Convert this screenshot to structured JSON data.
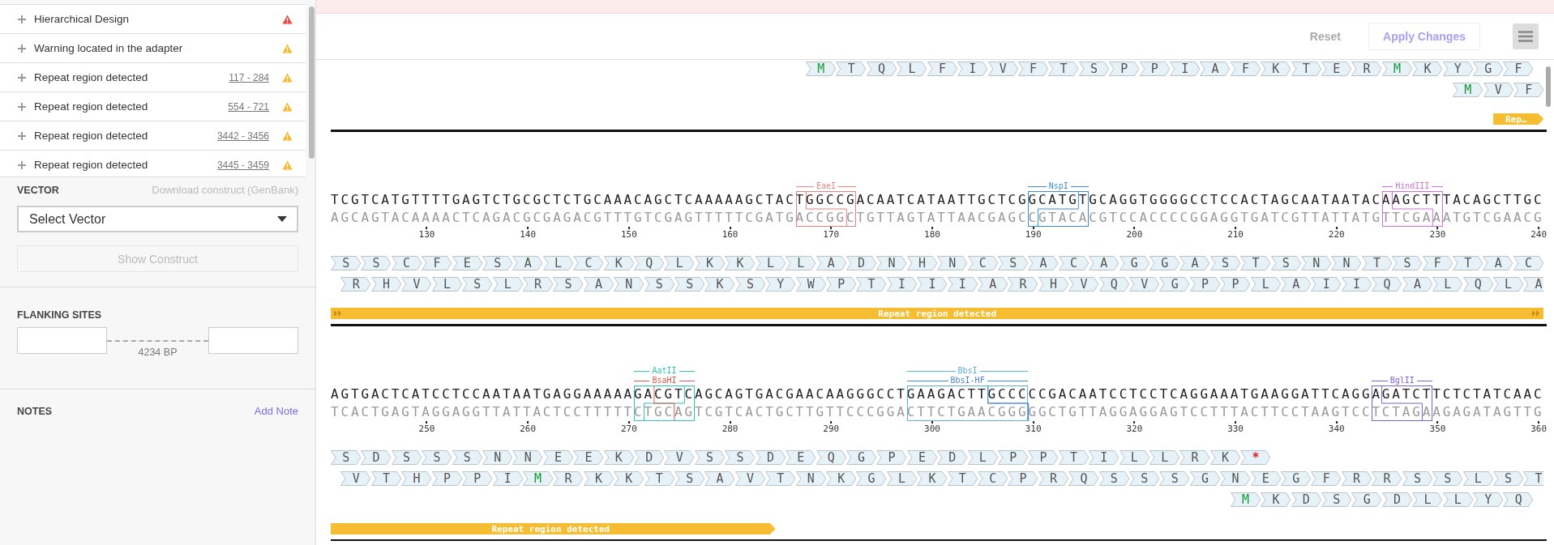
{
  "issues": [
    {
      "label": "Hierarchical Design",
      "kind": "error"
    },
    {
      "label": "Warning located in the adapter",
      "kind": "warning"
    },
    {
      "label": "Repeat region detected",
      "range": "117 - 284",
      "kind": "warning"
    },
    {
      "label": "Repeat region detected",
      "range": "554 - 721",
      "kind": "warning"
    },
    {
      "label": "Repeat region detected",
      "range": "3442 - 3456",
      "kind": "warning"
    },
    {
      "label": "Repeat region detected",
      "range": "3445 - 3459",
      "kind": "warning"
    }
  ],
  "vector": {
    "title": "VECTOR",
    "download_link": "Download construct (GenBank)",
    "select": {
      "value": "Select Vector"
    },
    "show_button": {
      "label": "Show Construct",
      "disabled": true
    }
  },
  "flanking": {
    "title": "FLANKING SITES",
    "length": "4234 BP"
  },
  "notes": {
    "title": "NOTES",
    "add_link": "Add Note"
  },
  "toolbar": {
    "reset": {
      "label": "Reset",
      "disabled": true
    },
    "apply": {
      "label": "Apply Changes",
      "disabled": true
    }
  },
  "rows": [
    {
      "tracks": [
        {
          "residues": [
            {
              "aa": "M",
              "kind": "start"
            },
            {
              "aa": "T",
              "kind": "plain"
            },
            {
              "aa": "Q",
              "kind": "plain"
            },
            {
              "aa": "L",
              "kind": "plain"
            },
            {
              "aa": "F",
              "kind": "plain"
            },
            {
              "aa": "I",
              "kind": "plain"
            },
            {
              "aa": "V",
              "kind": "plain"
            },
            {
              "aa": "F",
              "kind": "plain"
            },
            {
              "aa": "T",
              "kind": "plain"
            },
            {
              "aa": "S",
              "kind": "plain"
            },
            {
              "aa": "P",
              "kind": "plain"
            },
            {
              "aa": "P",
              "kind": "plain"
            },
            {
              "aa": "I",
              "kind": "plain"
            },
            {
              "aa": "A",
              "kind": "plain"
            },
            {
              "aa": "F",
              "kind": "plain"
            },
            {
              "aa": "K",
              "kind": "plain"
            },
            {
              "aa": "T",
              "kind": "plain"
            },
            {
              "aa": "E",
              "kind": "plain"
            },
            {
              "aa": "R",
              "kind": "plain"
            },
            {
              "aa": "M",
              "kind": "start"
            },
            {
              "aa": "K",
              "kind": "plain"
            },
            {
              "aa": "Y",
              "kind": "plain"
            },
            {
              "aa": "G",
              "kind": "plain"
            },
            {
              "aa": "F",
              "kind": "plain"
            }
          ]
        },
        {
          "residues": [
            {
              "aa": "M",
              "kind": "start"
            },
            {
              "aa": "V",
              "kind": "plain"
            },
            {
              "aa": "F",
              "kind": "plain"
            }
          ]
        }
      ],
      "features": [
        {
          "label": "Rep…"
        }
      ]
    },
    {
      "enzymes": [
        {
          "name": "EaeI",
          "color": "#f07f7f"
        },
        {
          "name": "NspI",
          "color": "#3a8fd8"
        },
        {
          "name": "HindIII",
          "color": "#d36ee0"
        }
      ],
      "top_strand": "TCGTCATGTTTTGAGTCTGCGCTCTGCAAACAGCTCAAAAAGCTACTGGCCGACAATCATAATTGCTCGGCATGTGCAGGTGGGGCCTCCACTAGCAATAATACAAGCTTTACAGCTTGC",
      "bottom_strand": "AGCAGTACAAAACTCAGACGCGAGACGTTTGTCGAGTTTTTCGATGACCGGCTGTTAGTATTAACGAGCCGTACACGTCCACCCCGGAGGTGATCGTTATTATGTTCGAAATGTCGAACG",
      "ticks": [
        "130",
        "140",
        "150",
        "160",
        "170",
        "180",
        "190",
        "200",
        "210",
        "220",
        "230",
        "240"
      ],
      "tracks": [
        {
          "residues": [
            {
              "aa": "S",
              "kind": "plain"
            },
            {
              "aa": "S",
              "kind": "plain"
            },
            {
              "aa": "C",
              "kind": "plain"
            },
            {
              "aa": "F",
              "kind": "plain"
            },
            {
              "aa": "E",
              "kind": "plain"
            },
            {
              "aa": "S",
              "kind": "plain"
            },
            {
              "aa": "A",
              "kind": "plain"
            },
            {
              "aa": "L",
              "kind": "plain"
            },
            {
              "aa": "C",
              "kind": "plain"
            },
            {
              "aa": "K",
              "kind": "plain"
            },
            {
              "aa": "Q",
              "kind": "plain"
            },
            {
              "aa": "L",
              "kind": "plain"
            },
            {
              "aa": "K",
              "kind": "plain"
            },
            {
              "aa": "K",
              "kind": "plain"
            },
            {
              "aa": "L",
              "kind": "plain"
            },
            {
              "aa": "L",
              "kind": "plain"
            },
            {
              "aa": "A",
              "kind": "plain"
            },
            {
              "aa": "D",
              "kind": "plain"
            },
            {
              "aa": "N",
              "kind": "plain"
            },
            {
              "aa": "H",
              "kind": "plain"
            },
            {
              "aa": "N",
              "kind": "plain"
            },
            {
              "aa": "C",
              "kind": "plain"
            },
            {
              "aa": "S",
              "kind": "plain"
            },
            {
              "aa": "A",
              "kind": "plain"
            },
            {
              "aa": "C",
              "kind": "plain"
            },
            {
              "aa": "A",
              "kind": "plain"
            },
            {
              "aa": "G",
              "kind": "plain"
            },
            {
              "aa": "G",
              "kind": "plain"
            },
            {
              "aa": "A",
              "kind": "plain"
            },
            {
              "aa": "S",
              "kind": "plain"
            },
            {
              "aa": "T",
              "kind": "plain"
            },
            {
              "aa": "S",
              "kind": "plain"
            },
            {
              "aa": "N",
              "kind": "plain"
            },
            {
              "aa": "N",
              "kind": "plain"
            },
            {
              "aa": "T",
              "kind": "plain"
            },
            {
              "aa": "S",
              "kind": "plain"
            },
            {
              "aa": "F",
              "kind": "plain"
            },
            {
              "aa": "T",
              "kind": "plain"
            },
            {
              "aa": "A",
              "kind": "plain"
            },
            {
              "aa": "C",
              "kind": "plain"
            }
          ]
        },
        {
          "residues": [
            {
              "aa": "R",
              "kind": "plain"
            },
            {
              "aa": "H",
              "kind": "plain"
            },
            {
              "aa": "V",
              "kind": "plain"
            },
            {
              "aa": "L",
              "kind": "plain"
            },
            {
              "aa": "S",
              "kind": "plain"
            },
            {
              "aa": "L",
              "kind": "plain"
            },
            {
              "aa": "R",
              "kind": "plain"
            },
            {
              "aa": "S",
              "kind": "plain"
            },
            {
              "aa": "A",
              "kind": "plain"
            },
            {
              "aa": "N",
              "kind": "plain"
            },
            {
              "aa": "S",
              "kind": "plain"
            },
            {
              "aa": "S",
              "kind": "plain"
            },
            {
              "aa": "K",
              "kind": "plain"
            },
            {
              "aa": "S",
              "kind": "plain"
            },
            {
              "aa": "Y",
              "kind": "plain"
            },
            {
              "aa": "W",
              "kind": "plain"
            },
            {
              "aa": "P",
              "kind": "plain"
            },
            {
              "aa": "T",
              "kind": "plain"
            },
            {
              "aa": "I",
              "kind": "plain"
            },
            {
              "aa": "I",
              "kind": "plain"
            },
            {
              "aa": "I",
              "kind": "plain"
            },
            {
              "aa": "A",
              "kind": "plain"
            },
            {
              "aa": "R",
              "kind": "plain"
            },
            {
              "aa": "H",
              "kind": "plain"
            },
            {
              "aa": "V",
              "kind": "plain"
            },
            {
              "aa": "Q",
              "kind": "plain"
            },
            {
              "aa": "V",
              "kind": "plain"
            },
            {
              "aa": "G",
              "kind": "plain"
            },
            {
              "aa": "P",
              "kind": "plain"
            },
            {
              "aa": "P",
              "kind": "plain"
            },
            {
              "aa": "L",
              "kind": "plain"
            },
            {
              "aa": "A",
              "kind": "plain"
            },
            {
              "aa": "I",
              "kind": "plain"
            },
            {
              "aa": "I",
              "kind": "plain"
            },
            {
              "aa": "Q",
              "kind": "plain"
            },
            {
              "aa": "A",
              "kind": "plain"
            },
            {
              "aa": "L",
              "kind": "plain"
            },
            {
              "aa": "Q",
              "kind": "plain"
            },
            {
              "aa": "L",
              "kind": "plain"
            },
            {
              "aa": "A",
              "kind": "plain"
            }
          ]
        }
      ],
      "features": [
        {
          "label": "Repeat region detected"
        }
      ]
    },
    {
      "enzymes": [
        {
          "name": "AatII",
          "color": "#2cc7b8"
        },
        {
          "name": "BbsI",
          "color": "#5aaee0"
        },
        {
          "name": "BsaHI",
          "color": "#d9584f"
        },
        {
          "name": "BbsI-HF",
          "color": "#4a80d8"
        },
        {
          "name": "BglII",
          "color": "#7a63e0"
        }
      ],
      "top_strand": "AGTGACTCATCCTCCAATAATGAGGAAAAAGACGTCAGCAGTGACGAACAAGGGCCTGAAGACTTGCCCCCGACAATCCTCCTCAGGAAATGAAGGATTCAGGAGATCTTCTCTATCAAC",
      "bottom_strand": "TCACTGAGTAGGAGGTTATTACTCCTTTTTCTGCAGTCGTCACTGCTTGTTCCCGGACTTCTGAACGGGGGCTGTTAGGAGGAGTCCTTTACTTCCTAAGTCCTCTAGAAGAGATAGTTG",
      "ticks": [
        "250",
        "260",
        "270",
        "280",
        "290",
        "300",
        "310",
        "320",
        "330",
        "340",
        "350",
        "360"
      ],
      "tracks": [
        {
          "residues": [
            {
              "aa": "S",
              "kind": "plain"
            },
            {
              "aa": "D",
              "kind": "plain"
            },
            {
              "aa": "S",
              "kind": "plain"
            },
            {
              "aa": "S",
              "kind": "plain"
            },
            {
              "aa": "S",
              "kind": "plain"
            },
            {
              "aa": "N",
              "kind": "plain"
            },
            {
              "aa": "N",
              "kind": "plain"
            },
            {
              "aa": "E",
              "kind": "plain"
            },
            {
              "aa": "E",
              "kind": "plain"
            },
            {
              "aa": "K",
              "kind": "plain"
            },
            {
              "aa": "D",
              "kind": "plain"
            },
            {
              "aa": "V",
              "kind": "plain"
            },
            {
              "aa": "S",
              "kind": "plain"
            },
            {
              "aa": "S",
              "kind": "plain"
            },
            {
              "aa": "D",
              "kind": "plain"
            },
            {
              "aa": "E",
              "kind": "plain"
            },
            {
              "aa": "Q",
              "kind": "plain"
            },
            {
              "aa": "G",
              "kind": "plain"
            },
            {
              "aa": "P",
              "kind": "plain"
            },
            {
              "aa": "E",
              "kind": "plain"
            },
            {
              "aa": "D",
              "kind": "plain"
            },
            {
              "aa": "L",
              "kind": "plain"
            },
            {
              "aa": "P",
              "kind": "plain"
            },
            {
              "aa": "P",
              "kind": "plain"
            },
            {
              "aa": "T",
              "kind": "plain"
            },
            {
              "aa": "I",
              "kind": "plain"
            },
            {
              "aa": "L",
              "kind": "plain"
            },
            {
              "aa": "L",
              "kind": "plain"
            },
            {
              "aa": "R",
              "kind": "plain"
            },
            {
              "aa": "K",
              "kind": "plain"
            },
            {
              "aa": "*",
              "kind": "stop"
            }
          ]
        },
        {
          "residues": [
            {
              "aa": "V",
              "kind": "plain"
            },
            {
              "aa": "T",
              "kind": "plain"
            },
            {
              "aa": "H",
              "kind": "plain"
            },
            {
              "aa": "P",
              "kind": "plain"
            },
            {
              "aa": "P",
              "kind": "plain"
            },
            {
              "aa": "I",
              "kind": "plain"
            },
            {
              "aa": "M",
              "kind": "start"
            },
            {
              "aa": "R",
              "kind": "plain"
            },
            {
              "aa": "K",
              "kind": "plain"
            },
            {
              "aa": "K",
              "kind": "plain"
            },
            {
              "aa": "T",
              "kind": "plain"
            },
            {
              "aa": "S",
              "kind": "plain"
            },
            {
              "aa": "A",
              "kind": "plain"
            },
            {
              "aa": "V",
              "kind": "plain"
            },
            {
              "aa": "T",
              "kind": "plain"
            },
            {
              "aa": "N",
              "kind": "plain"
            },
            {
              "aa": "K",
              "kind": "plain"
            },
            {
              "aa": "G",
              "kind": "plain"
            },
            {
              "aa": "L",
              "kind": "plain"
            },
            {
              "aa": "K",
              "kind": "plain"
            },
            {
              "aa": "T",
              "kind": "plain"
            },
            {
              "aa": "C",
              "kind": "plain"
            },
            {
              "aa": "P",
              "kind": "plain"
            },
            {
              "aa": "R",
              "kind": "plain"
            },
            {
              "aa": "Q",
              "kind": "plain"
            },
            {
              "aa": "S",
              "kind": "plain"
            },
            {
              "aa": "S",
              "kind": "plain"
            },
            {
              "aa": "S",
              "kind": "plain"
            },
            {
              "aa": "G",
              "kind": "plain"
            },
            {
              "aa": "N",
              "kind": "plain"
            },
            {
              "aa": "E",
              "kind": "plain"
            },
            {
              "aa": "G",
              "kind": "plain"
            },
            {
              "aa": "F",
              "kind": "plain"
            },
            {
              "aa": "R",
              "kind": "plain"
            },
            {
              "aa": "R",
              "kind": "plain"
            },
            {
              "aa": "S",
              "kind": "plain"
            },
            {
              "aa": "S",
              "kind": "plain"
            },
            {
              "aa": "L",
              "kind": "plain"
            },
            {
              "aa": "S",
              "kind": "plain"
            },
            {
              "aa": "T",
              "kind": "plain"
            }
          ]
        },
        {
          "residues": [
            {
              "aa": "M",
              "kind": "start"
            },
            {
              "aa": "K",
              "kind": "plain"
            },
            {
              "aa": "D",
              "kind": "plain"
            },
            {
              "aa": "S",
              "kind": "plain"
            },
            {
              "aa": "G",
              "kind": "plain"
            },
            {
              "aa": "D",
              "kind": "plain"
            },
            {
              "aa": "L",
              "kind": "plain"
            },
            {
              "aa": "L",
              "kind": "plain"
            },
            {
              "aa": "Y",
              "kind": "plain"
            },
            {
              "aa": "Q",
              "kind": "plain"
            }
          ]
        }
      ],
      "features": [
        {
          "label": "Repeat region detected"
        }
      ]
    }
  ]
}
